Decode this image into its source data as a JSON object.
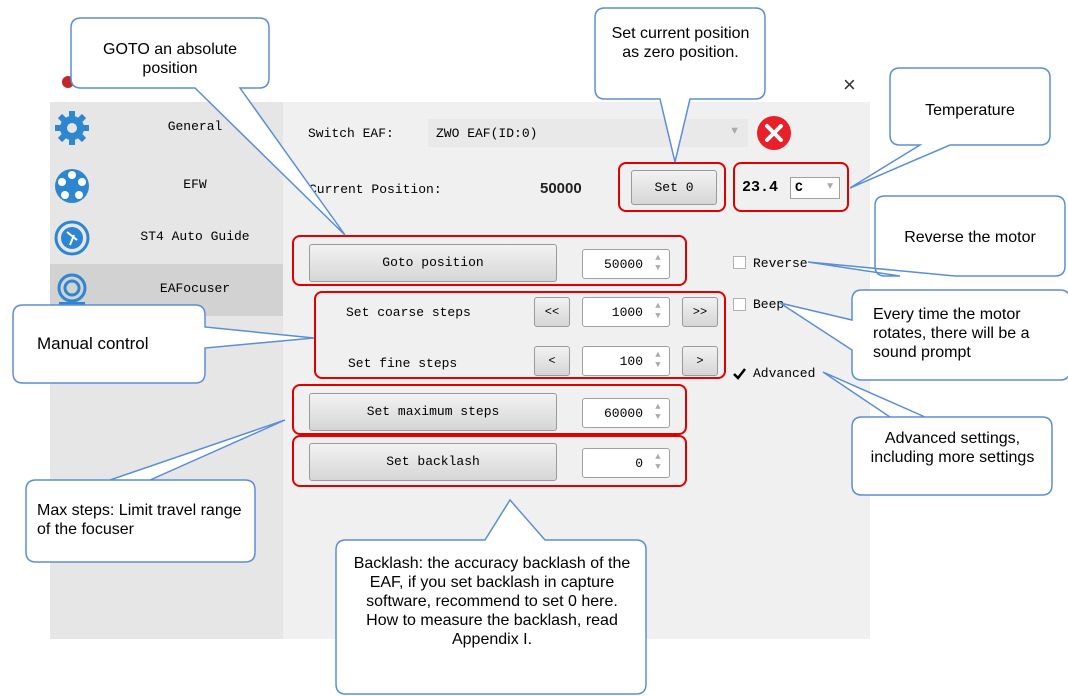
{
  "window": {
    "close_glyph": "×"
  },
  "sidebar": {
    "items": [
      {
        "label": "General",
        "icon": "gear-icon"
      },
      {
        "label": "EFW",
        "icon": "filter-wheel-icon"
      },
      {
        "label": "ST4 Auto Guide",
        "icon": "autoguide-icon"
      },
      {
        "label": "EAFocuser",
        "icon": "focuser-icon"
      }
    ]
  },
  "main": {
    "switch_label": "Switch EAF:",
    "switch_value": "ZWO EAF(ID:0)",
    "current_position_label": "Current Position:",
    "current_position_value": "50000",
    "set0_label": "Set 0",
    "temperature_value": "23.4",
    "temperature_unit": "C",
    "goto_label": "Goto position",
    "goto_value": "50000",
    "coarse_label": "Set coarse steps",
    "coarse_dec": "<<",
    "coarse_value": "1000",
    "coarse_inc": ">>",
    "fine_label": "Set fine steps",
    "fine_dec": "<",
    "fine_value": "100",
    "fine_inc": ">",
    "maxsteps_label": "Set maximum steps",
    "maxsteps_value": "60000",
    "backlash_label": "Set backlash",
    "backlash_value": "0",
    "reverse_label": "Reverse",
    "beep_label": "Beep",
    "advanced_label": "Advanced"
  },
  "callouts": {
    "goto": "GOTO an absolute position",
    "setzero": "Set current position as zero position.",
    "temperature": "Temperature",
    "reverse": "Reverse the motor",
    "beep": "Every time the motor rotates, there will be a sound prompt",
    "manual": "Manual control",
    "advanced": "Advanced settings, including more settings",
    "maxsteps": "Max steps: Limit travel range of the focuser",
    "backlash": "Backlash: the accuracy backlash of the EAF, if you set backlash in capture software, recommend to set 0 here. How to measure the backlash, read Appendix I."
  },
  "colors": {
    "highlight": "#e00000",
    "callout_border": "#5b8ed6",
    "close_button": "#e8202a"
  }
}
